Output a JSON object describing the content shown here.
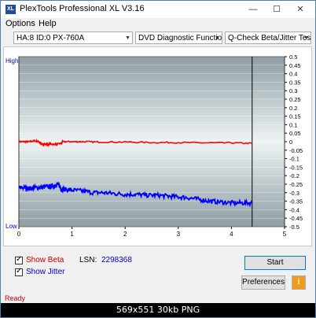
{
  "titlebar": {
    "title": "PlexTools Professional XL V3.16",
    "minimize": "—",
    "maximize": "☐",
    "close": "✕"
  },
  "menu": {
    "options": "Options",
    "help": "Help"
  },
  "toolbar": {
    "drive": "HA:8 ID:0  PX-760A",
    "function": "DVD Diagnostic Functions",
    "test": "Q-Check Beta/Jitter Test"
  },
  "chart_data": {
    "type": "line",
    "x_ticks": [
      "0",
      "1",
      "2",
      "3",
      "4",
      "5"
    ],
    "xlim": [
      0,
      5
    ],
    "y_right_ticks": [
      "0.5",
      "0.45",
      "0.4",
      "0.35",
      "0.3",
      "0.25",
      "0.2",
      "0.15",
      "0.1",
      "0.05",
      "0",
      "-0.05",
      "-0.1",
      "-0.15",
      "-0.2",
      "-0.25",
      "-0.3",
      "-0.35",
      "-0.4",
      "-0.45",
      "-0.5"
    ],
    "ylim": [
      -0.5,
      0.5
    ],
    "left_labels": {
      "high": "High",
      "low": "Low"
    },
    "end_marker_x": 4.39,
    "series": [
      {
        "color": "#ff0000",
        "x": [
          0,
          0.1,
          0.2,
          0.3,
          0.38,
          0.4,
          0.45,
          0.5,
          0.55,
          0.6,
          0.7,
          0.8,
          0.82,
          1.0,
          1.2,
          1.5,
          2.0,
          2.5,
          3.0,
          3.5,
          4.0,
          4.39
        ],
        "y": [
          0.0,
          0.0,
          0.0,
          0.005,
          0.0,
          -0.01,
          -0.015,
          -0.015,
          -0.015,
          -0.015,
          -0.015,
          -0.01,
          0.0,
          0.0,
          0.0,
          -0.002,
          -0.002,
          -0.005,
          -0.005,
          -0.007,
          -0.007,
          -0.01
        ]
      },
      {
        "color": "#0000ff",
        "x": [
          0,
          0.1,
          0.2,
          0.3,
          0.4,
          0.5,
          0.6,
          0.7,
          0.75,
          0.8,
          0.85,
          1.0,
          1.2,
          1.4,
          1.6,
          1.8,
          2.0,
          2.2,
          2.4,
          2.6,
          2.8,
          3.0,
          3.2,
          3.4,
          3.6,
          3.8,
          4.0,
          4.2,
          4.39
        ],
        "y": [
          -0.27,
          -0.27,
          -0.275,
          -0.27,
          -0.27,
          -0.265,
          -0.265,
          -0.255,
          -0.25,
          -0.28,
          -0.28,
          -0.285,
          -0.29,
          -0.3,
          -0.3,
          -0.305,
          -0.31,
          -0.31,
          -0.315,
          -0.315,
          -0.32,
          -0.325,
          -0.33,
          -0.34,
          -0.35,
          -0.355,
          -0.36,
          -0.36,
          -0.36
        ]
      }
    ]
  },
  "controls": {
    "show_beta": "Show Beta",
    "show_jitter": "Show Jitter",
    "lsn_label": "LSN:",
    "lsn_value": "2298368",
    "start": "Start",
    "preferences": "Preferences",
    "info_icon": "i"
  },
  "status": "Ready",
  "caption": "569x551  30kb  PNG"
}
